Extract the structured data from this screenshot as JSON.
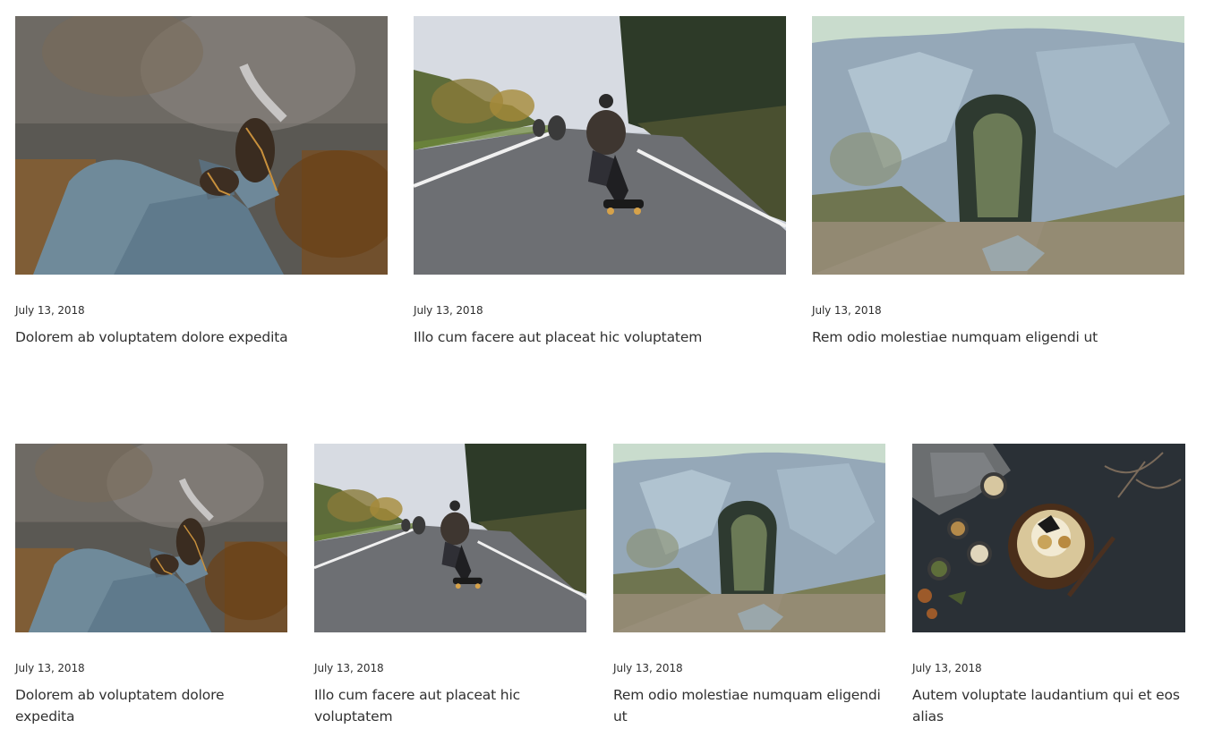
{
  "row1": [
    {
      "date": "July 13, 2018",
      "title": "Dolorem ab voluptatem dolore expedita",
      "image": "legs-sneakers-cliff-photo"
    },
    {
      "date": "July 13, 2018",
      "title": "Illo cum facere aut placeat hic voluptatem",
      "image": "skateboarders-road-photo"
    },
    {
      "date": "July 13, 2018",
      "title": "Rem odio molestiae numquam eligendi ut",
      "image": "rock-arch-photo"
    }
  ],
  "row2": [
    {
      "date": "July 13, 2018",
      "title": "Dolorem ab voluptatem dolore expedita",
      "image": "legs-sneakers-cliff-photo"
    },
    {
      "date": "July 13, 2018",
      "title": "Illo cum facere aut placeat hic voluptatem",
      "image": "skateboarders-road-photo"
    },
    {
      "date": "July 13, 2018",
      "title": "Rem odio molestiae numquam eligendi ut",
      "image": "rock-arch-photo"
    },
    {
      "date": "July 13, 2018",
      "title": "Autem voluptate laudantium qui et eos alias",
      "image": "cake-table-photo"
    }
  ]
}
